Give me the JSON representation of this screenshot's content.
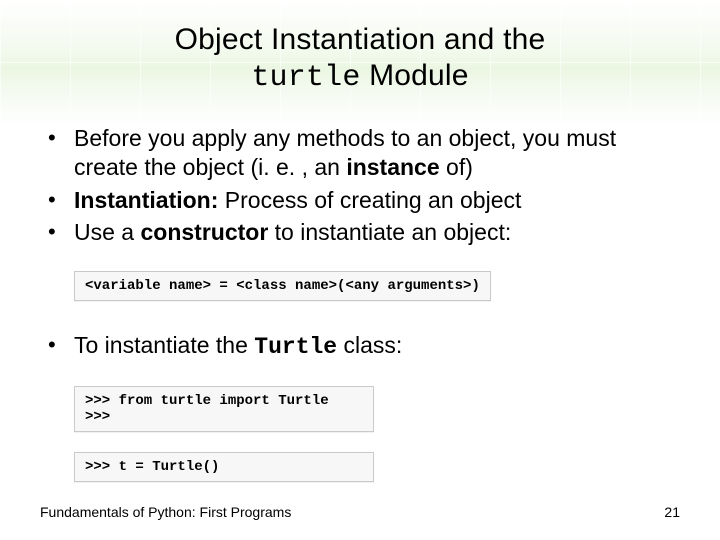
{
  "title": {
    "line1": "Object Instantiation and the",
    "code": "turtle",
    "line2_after": " Module"
  },
  "bullets1": [
    {
      "parts": [
        {
          "t": "Before you apply any methods to an object, you must create the object (i. e. , an "
        },
        {
          "t": "instance",
          "bold": true
        },
        {
          "t": " of)"
        }
      ]
    },
    {
      "parts": [
        {
          "t": "Instantiation:",
          "bold": true
        },
        {
          "t": " Process of creating an object"
        }
      ]
    },
    {
      "parts": [
        {
          "t": "Use a "
        },
        {
          "t": "constructor",
          "bold": true
        },
        {
          "t": " to instantiate an object:"
        }
      ]
    }
  ],
  "code1": "<variable name> = <class name>(<any arguments>)",
  "bullets2": [
    {
      "parts": [
        {
          "t": "To instantiate the "
        },
        {
          "t": "Turtle",
          "mono": true,
          "bold": true
        },
        {
          "t": " class:"
        }
      ]
    }
  ],
  "code2": ">>> from turtle import Turtle\n>>>",
  "code3": ">>> t = Turtle()",
  "footer": {
    "left": "Fundamentals of Python: First Programs",
    "page": "21"
  }
}
